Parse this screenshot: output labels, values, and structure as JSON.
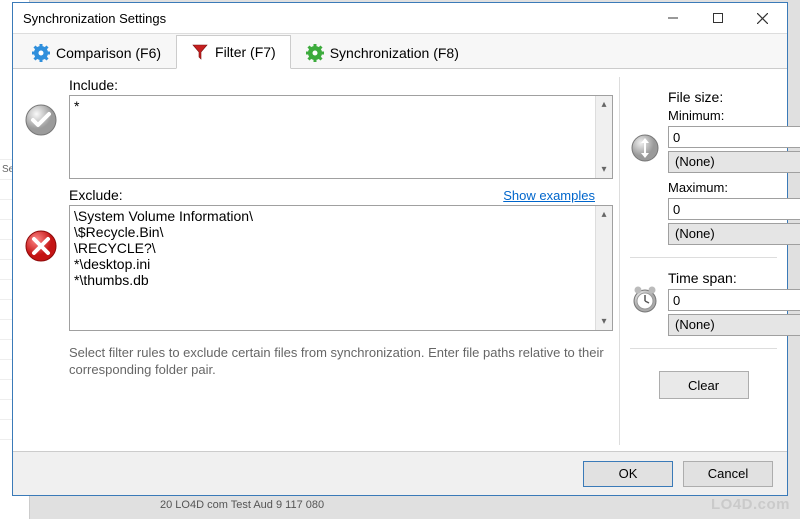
{
  "window": {
    "title": "Synchronization Settings"
  },
  "tabs": {
    "comparison": "Comparison (F6)",
    "filter": "Filter (F7)",
    "synchronization": "Synchronization (F8)"
  },
  "include": {
    "label": "Include:",
    "value": "*"
  },
  "exclude": {
    "label": "Exclude:",
    "show_examples": "Show examples",
    "value": "\\System Volume Information\\\n\\$Recycle.Bin\\\n\\RECYCLE?\\\n*\\desktop.ini\n*\\thumbs.db"
  },
  "help_text": "Select filter rules to exclude certain files from synchronization. Enter file paths relative to their corresponding folder pair.",
  "filesize": {
    "label": "File size:",
    "minimum_label": "Minimum:",
    "minimum_value": "0",
    "minimum_unit": "(None)",
    "maximum_label": "Maximum:",
    "maximum_value": "0",
    "maximum_unit": "(None)"
  },
  "timespan": {
    "label": "Time span:",
    "value": "0",
    "unit": "(None)"
  },
  "buttons": {
    "clear": "Clear",
    "ok": "OK",
    "cancel": "Cancel"
  },
  "background": {
    "statusbar": "20     LO4D com    Test Aud       9 117 080",
    "cut_tab": "Se"
  },
  "watermark": "LO4D.com"
}
